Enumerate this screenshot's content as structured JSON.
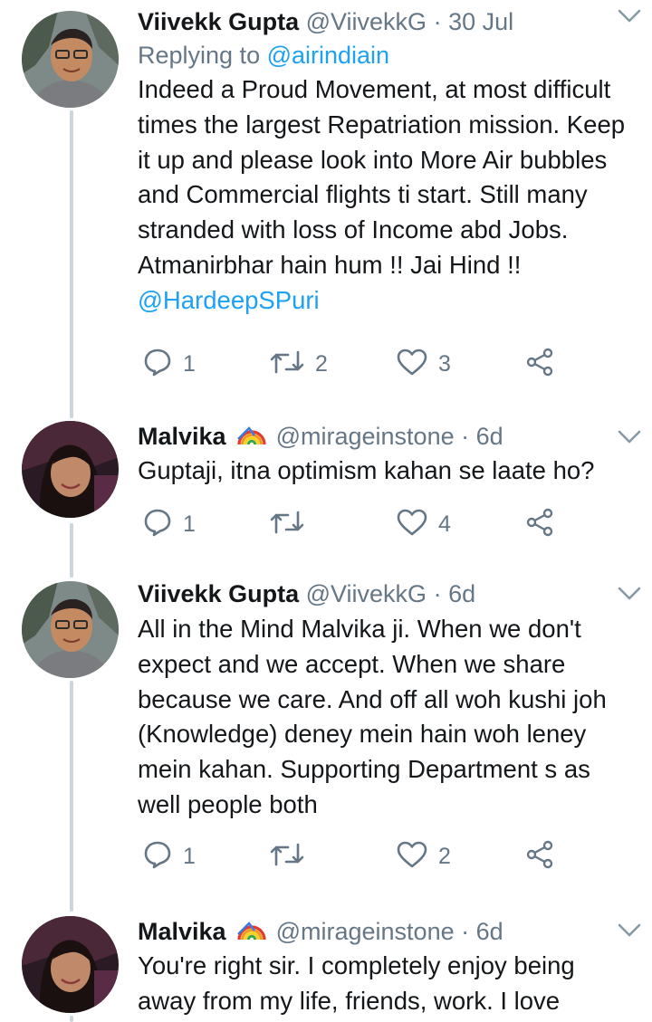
{
  "tweets": [
    {
      "name": "Viivekk Gupta",
      "handle": "@ViivekkG",
      "dot": "·",
      "time": "30 Jul",
      "reply_prefix": "Replying to ",
      "reply_to": "@airindiain",
      "text": "Indeed a Proud Movement, at most difficult times the largest Repatriation mission. Keep it up and please look into More Air bubbles and Commercial flights ti start. Still many stranded with loss of Income abd Jobs.  Atmanirbhar hain hum !! Jai Hind !! ",
      "text_mention": "@HardeepSPuri",
      "replies": "1",
      "retweets": "2",
      "likes": "3"
    },
    {
      "name": "Malvika",
      "emoji_icon": "rainbow-emoji",
      "handle": "@mirageinstone",
      "dot": "·",
      "time": "6d",
      "text": "Guptaji, itna optimism kahan se laate ho?",
      "replies": "1",
      "retweets": "",
      "likes": "4"
    },
    {
      "name": "Viivekk Gupta",
      "handle": "@ViivekkG",
      "dot": "·",
      "time": "6d",
      "text": "All in the Mind Malvika ji. When we don't expect and we accept. When we share because we care. And off all woh kushi joh (Knowledge) deney mein hain woh leney mein kahan. Supporting Department s as well people both",
      "replies": "1",
      "retweets": "",
      "likes": "2"
    },
    {
      "name": "Malvika",
      "emoji_icon": "rainbow-emoji",
      "handle": "@mirageinstone",
      "dot": "·",
      "time": "6d",
      "text": "You're right sir. I completely enjoy being away from my life, friends, work. I love"
    }
  ],
  "colors": {
    "text": "#14171a",
    "secondary": "#657786",
    "link": "#1da1f2",
    "thread_line": "#ccd6dd"
  }
}
